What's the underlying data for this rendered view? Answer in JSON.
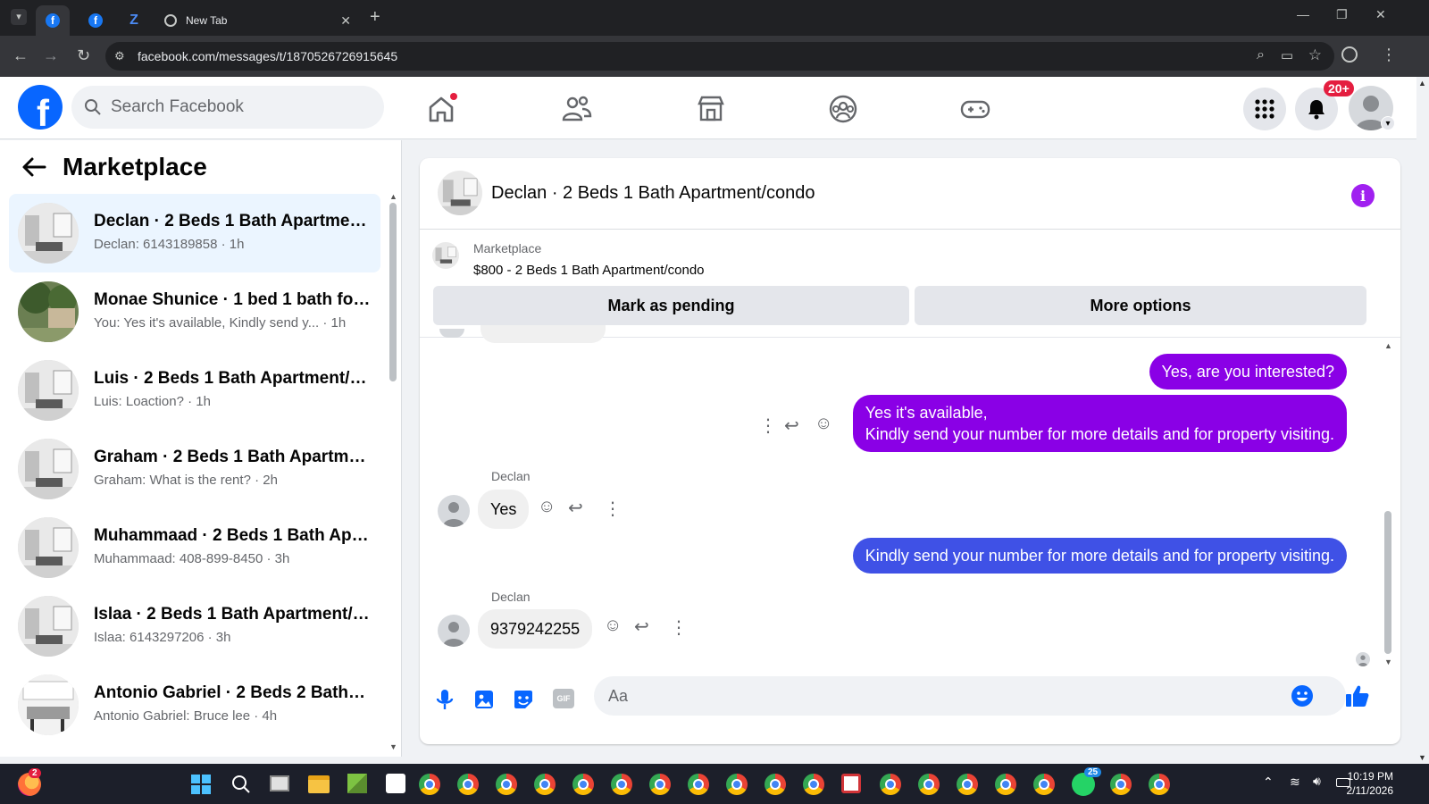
{
  "browser": {
    "tabs": [
      {
        "label": ""
      },
      {
        "label": ""
      },
      {
        "label": ""
      },
      {
        "label": "New Tab"
      }
    ],
    "url": "facebook.com/messages/t/1870526726915645"
  },
  "fb": {
    "search_placeholder": "Search Facebook",
    "notifications_badge": "20+"
  },
  "left": {
    "title": "Marketplace",
    "conversations": [
      {
        "name": "Declan · 2 Beds 1 Bath Apartmen...",
        "preview": "Declan: 6143189858 · 1h"
      },
      {
        "name": "Monae Shunice · 1 bed 1 bath for...",
        "preview": "You: Yes it's available, Kindly send y...  · 1h"
      },
      {
        "name": "Luis · 2 Beds 1 Bath Apartment/c...",
        "preview": "Luis: Loaction? · 1h"
      },
      {
        "name": "Graham · 2 Beds 1 Bath Apartme...",
        "preview": "Graham: What is the rent? · 2h"
      },
      {
        "name": "Muhammaad · 2 Beds 1 Bath Apa...",
        "preview": "Muhammaad: 408-899-8450 · 3h"
      },
      {
        "name": "Islaa · 2 Beds 1 Bath Apartment/c...",
        "preview": "Islaa: 6143297206 · 3h"
      },
      {
        "name": "Antonio Gabriel · 2 Beds 2 Baths ...",
        "preview": "Antonio Gabriel: Bruce lee · 4h"
      }
    ]
  },
  "chat": {
    "title": "Declan · 2 Beds 1 Bath Apartment/condo",
    "marketplace_label": "Marketplace",
    "listing": "$800 - 2 Beds 1 Bath Apartment/condo",
    "mark_pending": "Mark as pending",
    "more_options": "More options",
    "messages": {
      "out1": "Yes, are you interested?",
      "out2_line1": "Yes it's available,",
      "out2_line2": "Kindly send your number for more details and for property visiting.",
      "sender1": "Declan",
      "in1": "Yes",
      "out3": "Kindly send your number for more details and for property visiting.",
      "sender2": "Declan",
      "in2": "9379242255"
    },
    "composer_placeholder": "Aa"
  },
  "taskbar": {
    "time": "10:19 PM",
    "date": "2/11/2026",
    "firefox_badge": "2",
    "whatsapp_badge": "25"
  },
  "colors": {
    "fb_blue": "#0866ff",
    "outgoing_bubble": "#8a00e6",
    "last_outgoing_bubble": "#3f51e6"
  }
}
